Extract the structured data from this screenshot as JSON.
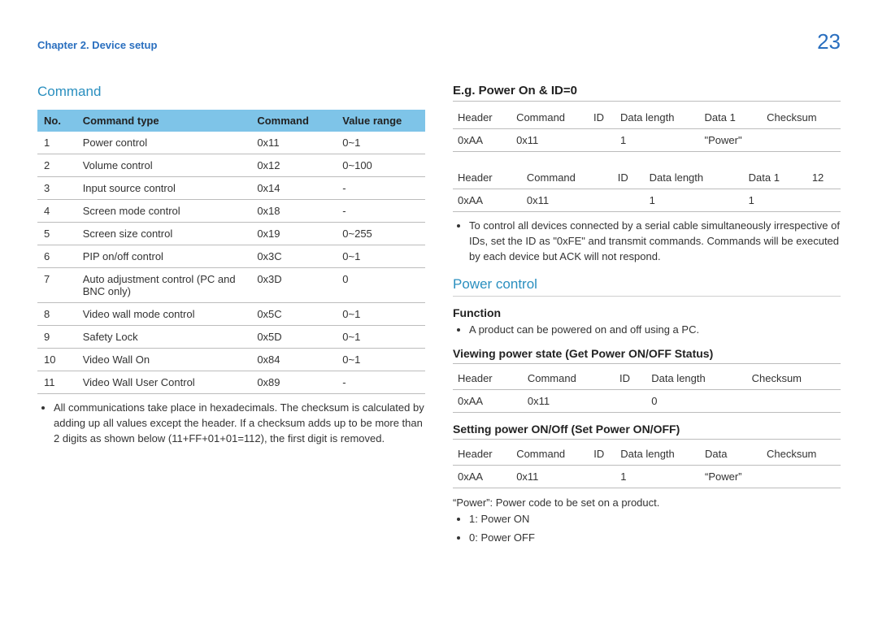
{
  "header": {
    "chapter": "Chapter 2. Device setup",
    "page_number": "23"
  },
  "left": {
    "section_title": "Command",
    "table_headers": {
      "no": "No.",
      "type": "Command type",
      "cmd": "Command",
      "range": "Value range"
    },
    "rows": [
      {
        "no": "1",
        "type": "Power control",
        "cmd": "0x11",
        "range": "0~1"
      },
      {
        "no": "2",
        "type": "Volume control",
        "cmd": "0x12",
        "range": "0~100"
      },
      {
        "no": "3",
        "type": "Input source control",
        "cmd": "0x14",
        "range": "-"
      },
      {
        "no": "4",
        "type": "Screen mode control",
        "cmd": "0x18",
        "range": "-"
      },
      {
        "no": "5",
        "type": "Screen size control",
        "cmd": "0x19",
        "range": "0~255"
      },
      {
        "no": "6",
        "type": "PIP on/off control",
        "cmd": "0x3C",
        "range": "0~1"
      },
      {
        "no": "7",
        "type": "Auto adjustment control (PC and BNC only)",
        "cmd": "0x3D",
        "range": "0"
      },
      {
        "no": "8",
        "type": "Video wall mode control",
        "cmd": "0x5C",
        "range": "0~1"
      },
      {
        "no": "9",
        "type": "Safety Lock",
        "cmd": "0x5D",
        "range": "0~1"
      },
      {
        "no": "10",
        "type": "Video Wall On",
        "cmd": "0x84",
        "range": "0~1"
      },
      {
        "no": "11",
        "type": "Video Wall User Control",
        "cmd": "0x89",
        "range": "-"
      }
    ],
    "note": "All communications take place in hexadecimals. The checksum is calculated by adding up all values except the header. If a checksum adds up to be more than 2 digits as shown below (11+FF+01+01=112), the first digit is removed."
  },
  "right": {
    "eg_title": "E.g. Power On & ID=0",
    "eg_table1": {
      "h": {
        "c1": "Header",
        "c2": "Command",
        "c3": "ID",
        "c4": "Data length",
        "c5": "Data 1",
        "c6": "Checksum"
      },
      "r": {
        "c1": "0xAA",
        "c2": "0x11",
        "c3": "",
        "c4": "1",
        "c5": "\"Power\"",
        "c6": ""
      }
    },
    "eg_table2": {
      "h": {
        "c1": "Header",
        "c2": "Command",
        "c3": "ID",
        "c4": "Data length",
        "c5": "Data 1",
        "c6": "12"
      },
      "r": {
        "c1": "0xAA",
        "c2": "0x11",
        "c3": "",
        "c4": "1",
        "c5": "1",
        "c6": ""
      }
    },
    "eg_note": "To control all devices connected by a serial cable simultaneously irrespective of IDs, set the ID as \"0xFE\" and transmit commands. Commands will be executed by each device but ACK will not respond.",
    "pc_title": "Power control",
    "pc_function_label": "Function",
    "pc_function_text": "A product can be powered on and off using a PC.",
    "pc_view_title": "Viewing power state (Get Power ON/OFF Status)",
    "pc_view_table": {
      "h": {
        "c1": "Header",
        "c2": "Command",
        "c3": "ID",
        "c4": "Data length",
        "c5": "Checksum"
      },
      "r": {
        "c1": "0xAA",
        "c2": "0x11",
        "c3": "",
        "c4": "0",
        "c5": ""
      }
    },
    "pc_set_title": "Setting power ON/Off (Set Power ON/OFF)",
    "pc_set_table": {
      "h": {
        "c1": "Header",
        "c2": "Command",
        "c3": "ID",
        "c4": "Data length",
        "c5": "Data",
        "c6": "Checksum"
      },
      "r": {
        "c1": "0xAA",
        "c2": "0x11",
        "c3": "",
        "c4": "1",
        "c5": "“Power”",
        "c6": ""
      }
    },
    "pc_power_note": "“Power”: Power code to be set on a product.",
    "pc_power_on": "1: Power ON",
    "pc_power_off": "0: Power OFF"
  }
}
